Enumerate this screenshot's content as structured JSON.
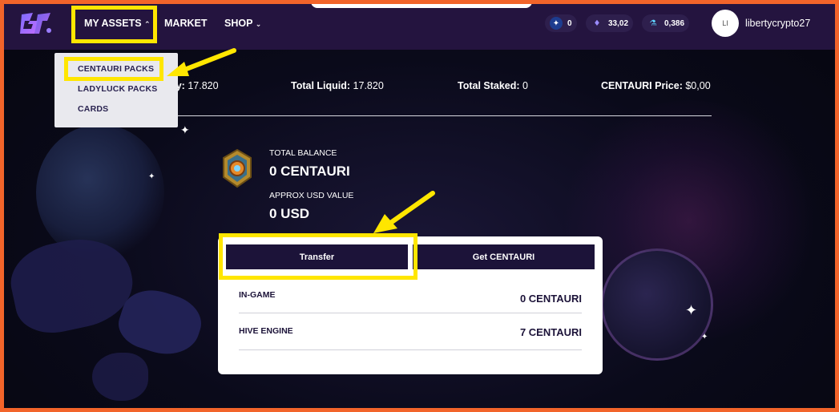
{
  "header": {
    "nav": {
      "my_assets": "MY ASSETS",
      "market": "MARKET",
      "shop": "SHOP"
    },
    "stats": [
      {
        "icon": "star-token-icon",
        "value": "0"
      },
      {
        "icon": "crystal-icon",
        "value": "33,02"
      },
      {
        "icon": "potion-icon",
        "value": "0,386"
      }
    ],
    "avatar_initials": "LI",
    "username": "libertycrypto27"
  },
  "dropdown": {
    "items": [
      "CENTAURI PACKS",
      "LADYLUCK PACKS",
      "CARDS"
    ]
  },
  "summary": {
    "supply_label": "Supply:",
    "supply_value": "17.820",
    "liquid_label": "Total Liquid:",
    "liquid_value": "17.820",
    "staked_label": "Total Staked:",
    "staked_value": "0",
    "price_label": "CENTAURI Price:",
    "price_value": "$0,00"
  },
  "balance": {
    "total_label": "TOTAL BALANCE",
    "total_value": "0 CENTAURI",
    "usd_label": "APPROX USD VALUE",
    "usd_value": "0 USD"
  },
  "card": {
    "transfer_label": "Transfer",
    "get_label": "Get CENTAURI",
    "rows": [
      {
        "label": "IN-GAME",
        "value": "0 CENTAURI"
      },
      {
        "label": "HIVE ENGINE",
        "value": "7 CENTAURI"
      }
    ]
  },
  "colors": {
    "highlight": "#ffe600",
    "border": "#f2642a",
    "topbar": "#24143f",
    "button": "#1c1339"
  }
}
